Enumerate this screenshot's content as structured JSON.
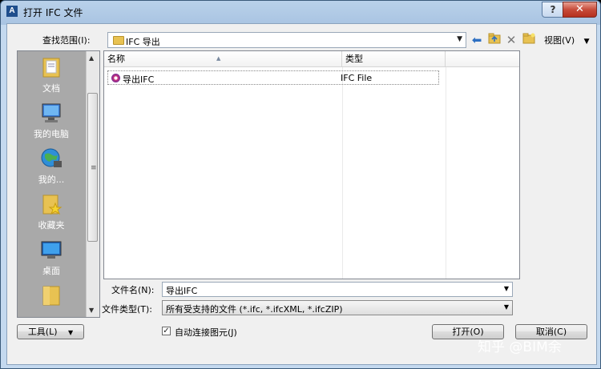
{
  "window": {
    "app_icon_letter": "A",
    "title": "打开 IFC 文件",
    "help_label": "?",
    "close_label": "✕"
  },
  "toolbar": {
    "lookin_label": "查找范围(I):",
    "lookin_value": "IFC 导出",
    "view_label": "视图(V)"
  },
  "sidebar": {
    "items": [
      {
        "label": "文档",
        "icon": "documents-icon"
      },
      {
        "label": "我的电脑",
        "icon": "computer-icon"
      },
      {
        "label": "我的...",
        "icon": "network-icon"
      },
      {
        "label": "收藏夹",
        "icon": "favorites-icon"
      },
      {
        "label": "桌面",
        "icon": "desktop-icon"
      },
      {
        "label": "",
        "icon": "folder-icon"
      }
    ]
  },
  "filelist": {
    "columns": [
      "名称",
      "类型"
    ],
    "rows": [
      {
        "name": "导出IFC",
        "type": "IFC File"
      }
    ]
  },
  "form": {
    "filename_label": "文件名(N):",
    "filename_value": "导出IFC",
    "filetype_label": "文件类型(T):",
    "filetype_value": "所有受支持的文件 (*.ifc, *.ifcXML, *.ifcZIP)",
    "auto_join_label": "自动连接图元(J)",
    "auto_join_checked": true
  },
  "buttons": {
    "tools": "工具(L)",
    "open": "打开(O)",
    "cancel": "取消(C)"
  },
  "watermark": "知乎 @BIM余"
}
